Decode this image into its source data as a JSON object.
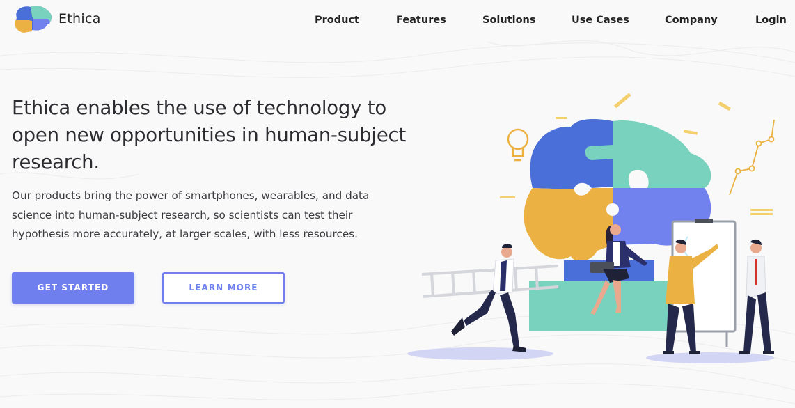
{
  "brand": {
    "name": "Ethica",
    "colors": {
      "blue": "#4b6fd8",
      "green": "#79d2bd",
      "yellow": "#ecb143",
      "purple": "#7181ee"
    }
  },
  "nav": {
    "items": [
      {
        "label": "Product"
      },
      {
        "label": "Features"
      },
      {
        "label": "Solutions"
      },
      {
        "label": "Use Cases"
      },
      {
        "label": "Company"
      },
      {
        "label": "Login"
      }
    ]
  },
  "hero": {
    "title_lines": [
      "Ethica enables the use of technology to",
      "open new opportunities in human-subject",
      "research."
    ],
    "subtitle_lines": [
      "Our products bring the power of smartphones, wearables, and data",
      "science into human-subject research, so scientists can test their",
      "hypothesis more accurately, at larger scales, with less resources."
    ],
    "primary_button": "GET STARTED",
    "secondary_button": "LEARN MORE"
  },
  "theme": {
    "accent": "#6f7fee",
    "text": "#2c2c30",
    "background": "#f9f9fa"
  },
  "illustration": {
    "icons": [
      "puzzle-brain-icon",
      "lightbulb-icon",
      "ladder-icon",
      "whiteboard-icon",
      "line-chart-icon"
    ]
  }
}
